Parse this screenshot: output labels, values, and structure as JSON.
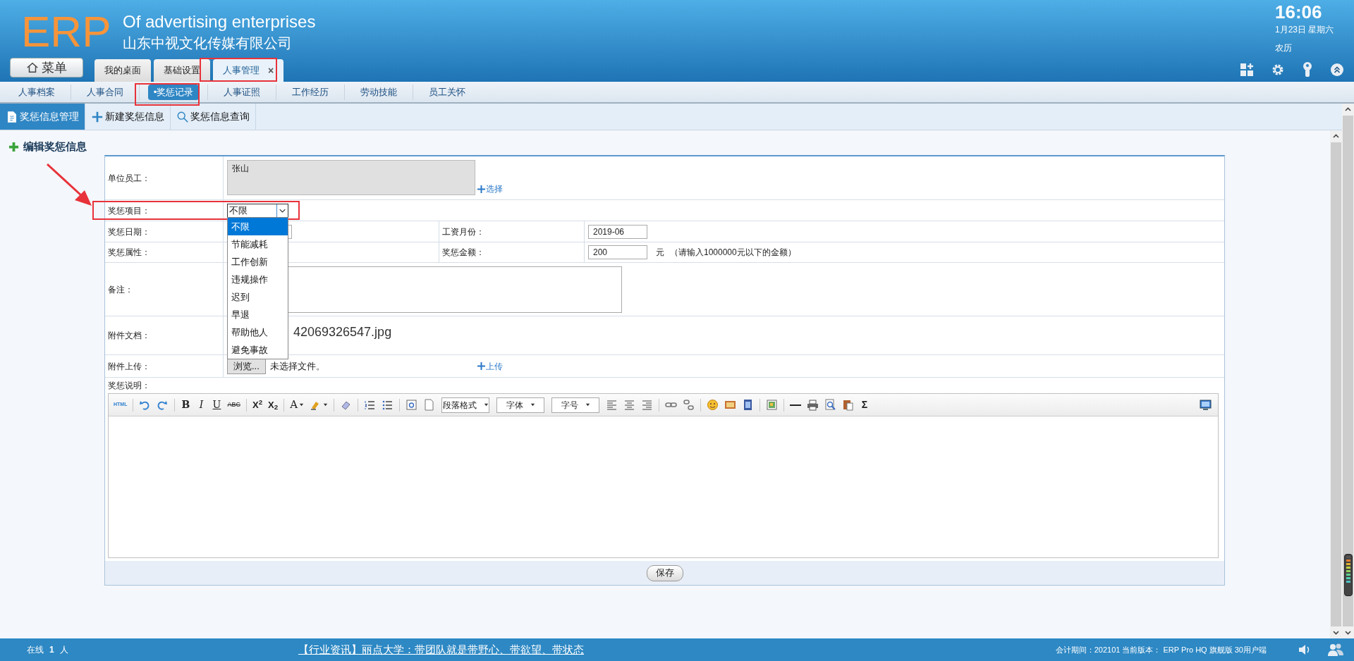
{
  "header": {
    "logo": "ERP",
    "title": "Of advertising enterprises",
    "company": "山东中视文化传媒有限公司",
    "menu_button": "菜单",
    "time": "16:06",
    "date": "1月23日 星期六",
    "lunar": "农历"
  },
  "tabs": [
    {
      "label": "我的桌面",
      "selected": false
    },
    {
      "label": "基础设置",
      "selected": false
    },
    {
      "label": "人事管理",
      "selected": true,
      "close_label": "×"
    }
  ],
  "subnav": [
    {
      "label": "人事档案",
      "selected": false
    },
    {
      "label": "人事合同",
      "selected": false
    },
    {
      "label": "•奖惩记录",
      "selected": true
    },
    {
      "label": "人事证照",
      "selected": false
    },
    {
      "label": "工作经历",
      "selected": false
    },
    {
      "label": "劳动技能",
      "selected": false
    },
    {
      "label": "员工关怀",
      "selected": false
    }
  ],
  "toolbar_tabs": [
    {
      "label": "奖惩信息管理",
      "selected": true
    },
    {
      "label": "新建奖惩信息",
      "selected": false
    },
    {
      "label": "奖惩信息查询",
      "selected": false
    }
  ],
  "section_title": "编辑奖惩信息",
  "form": {
    "employee": {
      "label": "单位员工：",
      "value": "张山",
      "link": "选择"
    },
    "item": {
      "label": "奖惩项目：",
      "value": "不限",
      "expanded": true,
      "options": [
        {
          "label": "不限",
          "selected": true
        },
        {
          "label": "节能减耗",
          "selected": false
        },
        {
          "label": "工作创新",
          "selected": false
        },
        {
          "label": "违规操作",
          "selected": false
        },
        {
          "label": "迟到",
          "selected": false
        },
        {
          "label": "早退",
          "selected": false
        },
        {
          "label": "帮助他人",
          "selected": false
        },
        {
          "label": "避免事故",
          "selected": false
        }
      ]
    },
    "date": {
      "label": "奖惩日期："
    },
    "salary_month": {
      "label": "工资月份：",
      "value": "2019-06"
    },
    "attribute": {
      "label": "奖惩属性："
    },
    "amount": {
      "label": "奖惩金额：",
      "value": "200",
      "unit": "元",
      "hint": "（请输入1000000元以下的金额）"
    },
    "note": {
      "label": "备注："
    },
    "attachment": {
      "label": "附件文档：",
      "file": "42069326547.jpg"
    },
    "upload": {
      "label": "附件上传：",
      "browse": "浏览...",
      "status": "未选择文件。",
      "link": "上传"
    },
    "description": {
      "label": "奖惩说明：",
      "toolbar": [
        {
          "kind": "text",
          "label": "HTML"
        },
        {
          "kind": "sep"
        },
        {
          "kind": "icon"
        },
        {
          "kind": "icon"
        },
        {
          "kind": "sep"
        },
        {
          "kind": "text",
          "label": "B"
        },
        {
          "kind": "text",
          "label": "I"
        },
        {
          "kind": "text",
          "label": "U"
        },
        {
          "kind": "text",
          "label": "ABC"
        },
        {
          "kind": "sep"
        },
        {
          "kind": "rich",
          "label": "X$^{2}$"
        },
        {
          "kind": "rich",
          "label": "X$_{2}$"
        },
        {
          "kind": "sep"
        },
        {
          "kind": "text",
          "label": "A",
          "caret": true
        },
        {
          "kind": "icon",
          "caret": true
        },
        {
          "kind": "sep"
        },
        {
          "kind": "icon"
        },
        {
          "kind": "sep"
        },
        {
          "kind": "icon"
        },
        {
          "kind": "icon"
        },
        {
          "kind": "sep"
        },
        {
          "kind": "icon"
        },
        {
          "kind": "icon"
        },
        {
          "kind": "dropdown",
          "label": "段落格式"
        },
        {
          "kind": "dropdown",
          "label": "字体"
        },
        {
          "kind": "dropdown",
          "label": "字号"
        },
        {
          "kind": "icon"
        },
        {
          "kind": "icon"
        },
        {
          "kind": "icon"
        },
        {
          "kind": "sep"
        },
        {
          "kind": "icon"
        },
        {
          "kind": "icon"
        },
        {
          "kind": "sep"
        },
        {
          "kind": "icon"
        },
        {
          "kind": "icon"
        },
        {
          "kind": "icon"
        },
        {
          "kind": "sep"
        },
        {
          "kind": "icon"
        },
        {
          "kind": "sep"
        },
        {
          "kind": "icon"
        },
        {
          "kind": "icon"
        },
        {
          "kind": "icon"
        },
        {
          "kind": "icon"
        },
        {
          "kind": "text",
          "label": "Σ"
        },
        {
          "kind": "icon"
        }
      ]
    },
    "save": "保存"
  },
  "status_bar": {
    "online_label": "在线",
    "online_count": "1",
    "online_unit": "人",
    "news": "【行业资讯】丽点大学：带团队就是带野心、带欲望、带状态",
    "info": "会计期间：202101 当前版本： ERP Pro HQ 旗舰版 30用户端"
  }
}
